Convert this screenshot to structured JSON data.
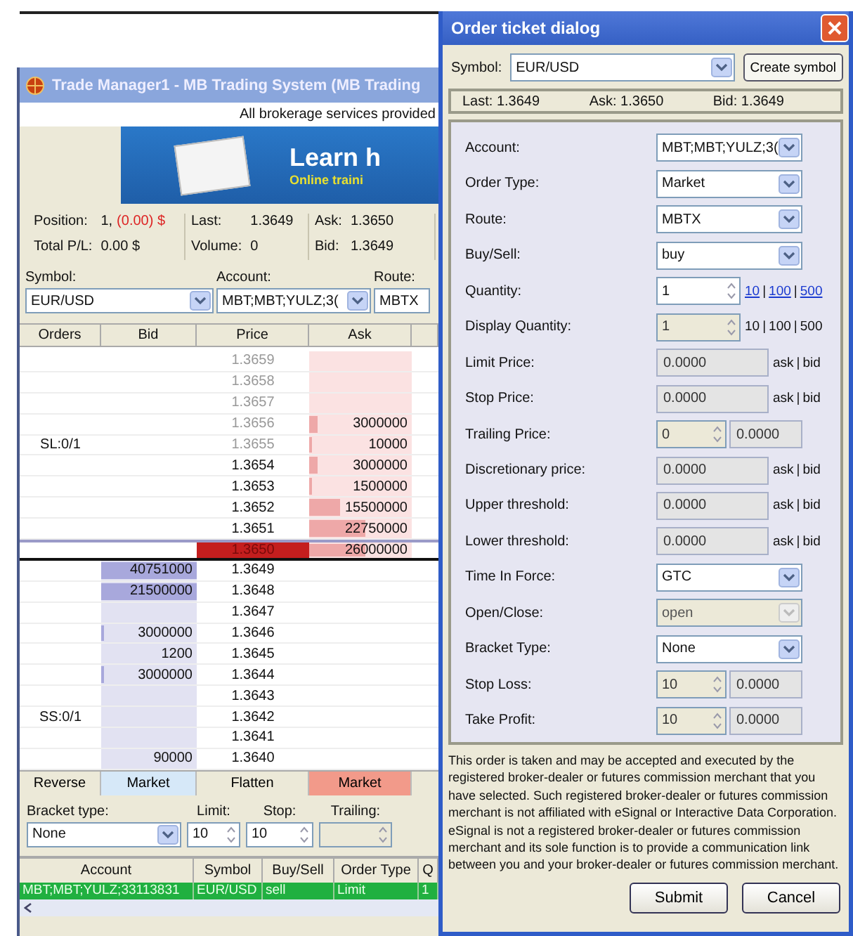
{
  "trade_manager": {
    "title": "Trade Manager1 - MB Trading System (MB Trading",
    "notice": "All brokerage services provided",
    "banner": {
      "headline": "Learn h",
      "subline": "Online traini"
    },
    "stats": [
      {
        "label": "Position:",
        "value": "1,",
        "extra": "(0.00) $",
        "negative": true
      },
      {
        "label": "Total P/L:",
        "value": "0.00 $"
      },
      {
        "label": "Last:",
        "value": "1.3649"
      },
      {
        "label": "Volume:",
        "value": "0"
      },
      {
        "label": "Ask:",
        "value": "1.3650"
      },
      {
        "label": "Bid:",
        "value": "1.3649"
      }
    ],
    "selectors": [
      {
        "label": "Symbol:",
        "value": "EUR/USD"
      },
      {
        "label": "Account:",
        "value": "MBT;MBT;YULZ;3("
      },
      {
        "label": "Route:",
        "value": "MBTX"
      }
    ],
    "ladder": {
      "columns": [
        "Orders",
        "Bid",
        "Price",
        "Ask"
      ],
      "rows": [
        {
          "price": "1.3659",
          "kind": "faded"
        },
        {
          "price": "1.3658",
          "kind": "faded"
        },
        {
          "price": "1.3657",
          "kind": "faded"
        },
        {
          "price": "1.3656",
          "kind": "faded",
          "ask": {
            "text": "3000000",
            "level": 0.08
          }
        },
        {
          "orders": "SL:0/1",
          "price": "1.3655",
          "kind": "faded",
          "ask": {
            "text": "10000",
            "level": 0.02
          }
        },
        {
          "price": "1.3654",
          "kind": "normal",
          "ask": {
            "text": "3000000",
            "level": 0.08
          }
        },
        {
          "price": "1.3653",
          "kind": "normal",
          "ask": {
            "text": "1500000",
            "level": 0.03
          }
        },
        {
          "price": "1.3652",
          "kind": "normal",
          "ask": {
            "text": "15500000",
            "level": 0.3
          }
        },
        {
          "price": "1.3651",
          "kind": "normal",
          "ask": {
            "text": "22750000",
            "level": 0.55
          }
        },
        {
          "price": "1.3650",
          "kind": "best",
          "ask": {
            "text": "26000000",
            "level": 0.55
          }
        },
        {
          "price": "1.3649",
          "kind": "normal",
          "bid": {
            "text": "40751000",
            "level": 1
          }
        },
        {
          "price": "1.3648",
          "kind": "normal",
          "bid": {
            "text": "21500000",
            "level": 1
          }
        },
        {
          "price": "1.3647",
          "kind": "normal"
        },
        {
          "price": "1.3646",
          "kind": "normal",
          "bid": {
            "text": "3000000",
            "level": 0.03
          }
        },
        {
          "price": "1.3645",
          "kind": "normal",
          "bid": {
            "text": "1200"
          }
        },
        {
          "price": "1.3644",
          "kind": "normal",
          "bid": {
            "text": "3000000",
            "level": 0.03
          }
        },
        {
          "price": "1.3643",
          "kind": "normal"
        },
        {
          "orders": "SS:0/1",
          "price": "1.3642",
          "kind": "normal"
        },
        {
          "price": "1.3641",
          "kind": "normal"
        },
        {
          "price": "1.3640",
          "kind": "normal",
          "bid": {
            "text": "90000"
          }
        }
      ]
    },
    "actions": [
      {
        "label": "Reverse",
        "kind": "plain"
      },
      {
        "label": "Market",
        "kind": "buy"
      },
      {
        "label": "Flatten",
        "kind": "plain"
      },
      {
        "label": "Market",
        "kind": "sell"
      }
    ],
    "bracket": {
      "labels": [
        "Bracket type:",
        "Limit:",
        "Stop:",
        "Trailing:"
      ],
      "type": "None",
      "limit": "10",
      "stop": "10"
    },
    "orders": {
      "columns": [
        "Account",
        "Symbol",
        "Buy/Sell",
        "Order Type",
        "Q"
      ],
      "rows": [
        {
          "cells": [
            "MBT;MBT;YULZ;33113831",
            "EUR/USD",
            "sell",
            "Limit",
            "1"
          ],
          "selected": true
        }
      ]
    }
  },
  "dialog": {
    "title": "Order ticket dialog",
    "symbol_label": "Symbol:",
    "symbol": "EUR/USD",
    "create_button": "Create symbol",
    "quote": [
      "Last: 1.3649",
      "Ask: 1.3650",
      "Bid: 1.3649"
    ],
    "fields": [
      {
        "label": "Account:",
        "kind": "select",
        "value": "MBT;MBT;YULZ;3(",
        "disabled": false
      },
      {
        "label": "Order Type:",
        "kind": "select",
        "value": "Market",
        "disabled": false
      },
      {
        "label": "Route:",
        "kind": "select",
        "value": "MBTX",
        "disabled": false
      },
      {
        "label": "Buy/Sell:",
        "kind": "select",
        "value": "buy",
        "disabled": false
      },
      {
        "label": "Quantity:",
        "kind": "spin",
        "value": "1",
        "links": [
          "10",
          "100",
          "500"
        ],
        "separator": "|",
        "disabled": false
      },
      {
        "label": "Display Quantity:",
        "kind": "spin",
        "value": "1",
        "links": [
          "10",
          "100",
          "500"
        ],
        "separator": "|",
        "disabled": true
      },
      {
        "label": "Limit Price:",
        "kind": "price",
        "value": "0.0000",
        "links": [
          "ask",
          "bid"
        ],
        "separator": "|",
        "disabled": true
      },
      {
        "label": "Stop Price:",
        "kind": "price",
        "value": "0.0000",
        "links": [
          "ask",
          "bid"
        ],
        "separator": "|",
        "disabled": true
      },
      {
        "label": "Trailing Price:",
        "kind": "spin",
        "value": "0",
        "second": "0.0000",
        "disabled": true
      },
      {
        "label": "Discretionary price:",
        "kind": "price",
        "value": "0.0000",
        "links": [
          "ask",
          "bid"
        ],
        "separator": "|",
        "disabled": true
      },
      {
        "label": "Upper threshold:",
        "kind": "price",
        "value": "0.0000",
        "links": [
          "ask",
          "bid"
        ],
        "separator": "|",
        "disabled": true
      },
      {
        "label": "Lower threshold:",
        "kind": "price",
        "value": "0.0000",
        "links": [
          "ask",
          "bid"
        ],
        "separator": "|",
        "disabled": true
      },
      {
        "label": "Time In Force:",
        "kind": "select",
        "value": "GTC",
        "disabled": false
      },
      {
        "label": "Open/Close:",
        "kind": "select",
        "value": "open",
        "disabled": true
      },
      {
        "label": "Bracket Type:",
        "kind": "select",
        "value": "None",
        "disabled": false
      },
      {
        "label": "Stop Loss:",
        "kind": "spin",
        "value": "10",
        "second": "0.0000",
        "disabled": true
      },
      {
        "label": "Take Profit:",
        "kind": "spin",
        "value": "10",
        "second": "0.0000",
        "disabled": true
      }
    ],
    "disclaimer": "This order is taken and may be accepted and executed by the registered broker-dealer or futures commission merchant that you have selected. Such registered broker-dealer or futures commission merchant is not affiliated with eSignal or Interactive Data Corporation. eSignal is not a registered broker-dealer or futures commission merchant and its sole function is to provide a communication link between you and your broker-dealer or futures commission merchant.",
    "buttons": [
      "Submit",
      "Cancel"
    ]
  }
}
